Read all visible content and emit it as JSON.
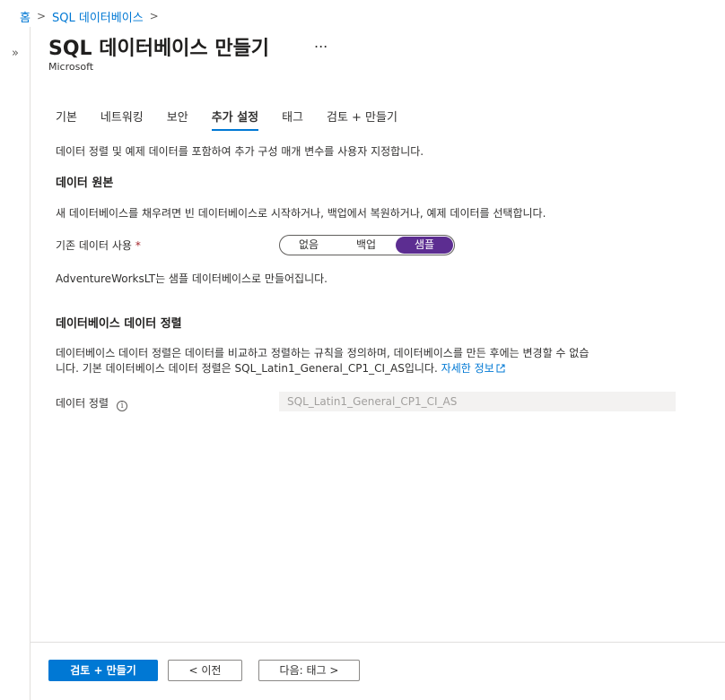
{
  "breadcrumb": {
    "items": [
      "홈",
      "SQL 데이터베이스"
    ],
    "separator": ">"
  },
  "header": {
    "title": "SQL 데이터베이스 만들기",
    "more_label": "...",
    "subtitle": "Microsoft"
  },
  "left_rail": {
    "expand_label": "»"
  },
  "tabs": [
    {
      "label": "기본"
    },
    {
      "label": "네트워킹"
    },
    {
      "label": "보안"
    },
    {
      "label": "추가 설정",
      "active": true
    },
    {
      "label": "태그"
    },
    {
      "label": "검토 + 만들기"
    }
  ],
  "main": {
    "intro": "데이터 정렬 및 예제 데이터를 포함하여 추가 구성 매개 변수를 사용자 지정합니다.",
    "data_source": {
      "heading": "데이터 원본",
      "description": "새 데이터베이스를 채우려면 빈 데이터베이스로 시작하거나, 백업에서 복원하거나, 예제 데이터를 선택합니다.",
      "field_label": "기존 데이터 사용",
      "required_mark": "*",
      "options": [
        "없음",
        "백업",
        "샘플"
      ],
      "selected": "샘플",
      "note": "AdventureWorksLT는 샘플 데이터베이스로 만들어집니다."
    },
    "collation": {
      "heading": "데이터베이스 데이터 정렬",
      "description_line1": "데이터베이스 데이터 정렬은 데이터를 비교하고 정렬하는 규칙을 정의하며, 데이터베이스를 만든 후에는 변경할 수 없습",
      "description_line2": "니다. 기본 데이터베이스 데이터 정렬은 SQL_Latin1_General_CP1_CI_AS입니다.",
      "learn_more": "자세한 정보",
      "field_label": "데이터 정렬",
      "info_glyph": "i",
      "value": "SQL_Latin1_General_CP1_CI_AS"
    }
  },
  "footer": {
    "review_create": "검토 + 만들기",
    "previous": "< 이전",
    "next": "다음: 태그 >"
  },
  "colors": {
    "accent": "#0078d4",
    "toggle_selected": "#5c2d91",
    "required": "#a4262c"
  }
}
